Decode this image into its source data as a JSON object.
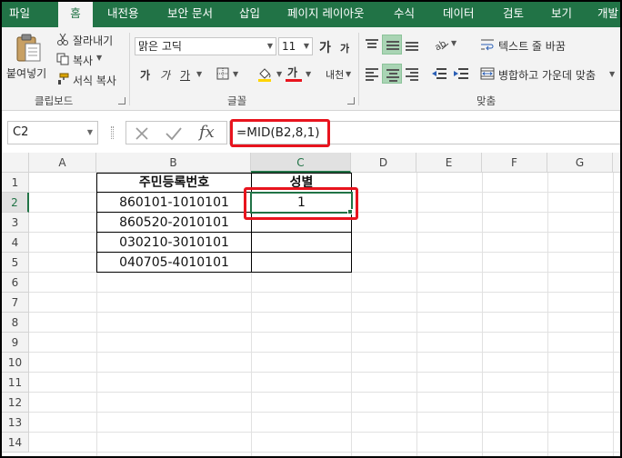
{
  "tabs": [
    "파일",
    "홈",
    "내전용",
    "보안 문서",
    "삽입",
    "페이지 레이아웃",
    "수식",
    "데이터",
    "검토",
    "보기",
    "개발"
  ],
  "ribbon": {
    "clipboard": {
      "paste": "붙여넣기",
      "cut": "잘라내기",
      "copy": "복사",
      "format_painter": "서식 복사",
      "label": "클립보드"
    },
    "font": {
      "name": "맑은 고딕",
      "size": "11",
      "grow": "가",
      "shrink": "가",
      "bold": "가",
      "italic": "가",
      "underline": "가",
      "font_color": "가",
      "phonetic": "내천",
      "label": "글꼴"
    },
    "alignment": {
      "wrap": "텍스트 줄 바꿈",
      "merge": "병합하고 가운데 맞춤",
      "label": "맞춤"
    }
  },
  "formula_bar": {
    "name_box": "C2",
    "fx": "fx",
    "formula": "=MID(B2,8,1)"
  },
  "sheet": {
    "columns": [
      "A",
      "B",
      "C",
      "D",
      "E",
      "F",
      "G"
    ],
    "rows": [
      "1",
      "2",
      "3",
      "4",
      "5",
      "6",
      "7",
      "8",
      "9",
      "10",
      "11",
      "12",
      "13",
      "14"
    ],
    "header_b": "주민등록번호",
    "header_c": "성별",
    "ids": [
      "860101-1010101",
      "860520-2010101",
      "030210-3010101",
      "040705-4010101"
    ],
    "c2_value": "1"
  },
  "colors": {
    "excel_green": "#217346",
    "highlight_red": "#e8141e",
    "active_align": "#a9d4b4"
  }
}
